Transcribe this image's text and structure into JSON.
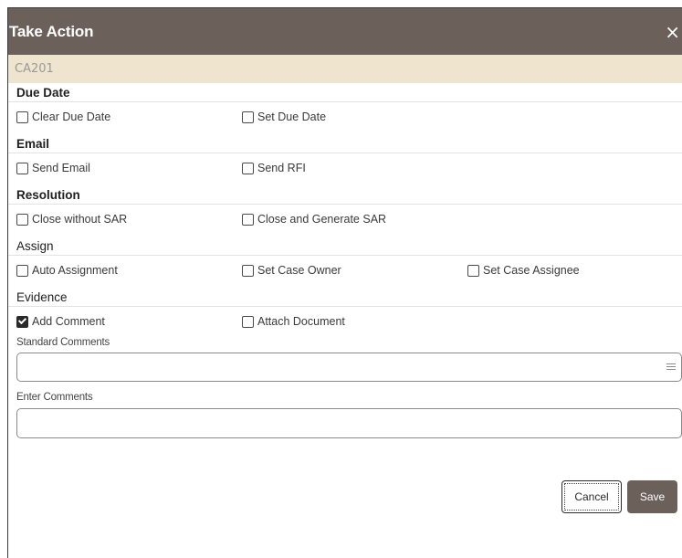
{
  "dialog": {
    "title": "Take Action",
    "close_glyph": "×",
    "case_id": "CA201"
  },
  "sections": {
    "due_date": {
      "title": "Due Date",
      "options": [
        {
          "label": "Clear Due Date",
          "checked": false
        },
        {
          "label": "Set Due Date",
          "checked": false
        }
      ]
    },
    "email": {
      "title": "Email",
      "options": [
        {
          "label": "Send Email",
          "checked": false
        },
        {
          "label": "Send RFI",
          "checked": false
        }
      ]
    },
    "resolution": {
      "title": "Resolution",
      "options": [
        {
          "label": "Close without SAR",
          "checked": false
        },
        {
          "label": "Close and Generate SAR",
          "checked": false
        }
      ]
    },
    "assign": {
      "title": "Assign",
      "options": [
        {
          "label": "Auto Assignment",
          "checked": false
        },
        {
          "label": "Set Case Owner",
          "checked": false
        },
        {
          "label": "Set Case Assignee",
          "checked": false
        }
      ]
    },
    "evidence": {
      "title": "Evidence",
      "options": [
        {
          "label": "Add Comment",
          "checked": true
        },
        {
          "label": "Attach Document",
          "checked": false
        }
      ]
    }
  },
  "fields": {
    "standard_comments": {
      "label": "Standard Comments",
      "value": "",
      "icon": "list-icon"
    },
    "enter_comments": {
      "label": "Enter Comments",
      "value": ""
    }
  },
  "buttons": {
    "cancel": "Cancel",
    "save": "Save"
  },
  "colors": {
    "titlebar": "#6b615a",
    "idbar": "#efe4cd",
    "save_button": "#6b615a"
  }
}
